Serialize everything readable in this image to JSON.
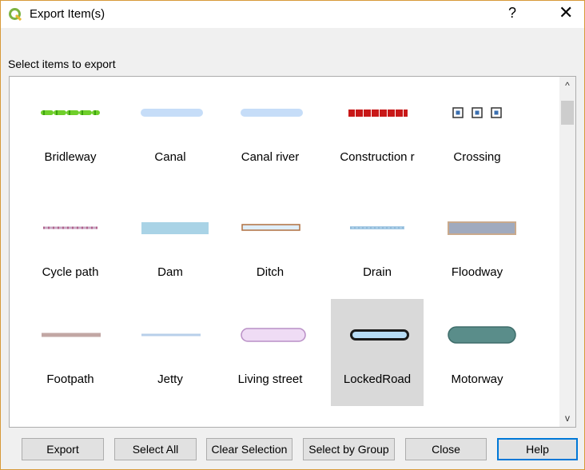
{
  "window": {
    "title": "Export Item(s)",
    "help_glyph": "?",
    "close_glyph": "✕"
  },
  "prompt": "Select items to export",
  "items": [
    {
      "label": "Bridleway",
      "symbol": "bridleway"
    },
    {
      "label": "Canal",
      "symbol": "canal"
    },
    {
      "label": "Canal river",
      "symbol": "canal-river"
    },
    {
      "label": "Construction r",
      "symbol": "construction"
    },
    {
      "label": "Crossing",
      "symbol": "crossing"
    },
    {
      "label": "Cycle path",
      "symbol": "cycle-path"
    },
    {
      "label": "Dam",
      "symbol": "dam"
    },
    {
      "label": "Ditch",
      "symbol": "ditch"
    },
    {
      "label": "Drain",
      "symbol": "drain"
    },
    {
      "label": "Floodway",
      "symbol": "floodway"
    },
    {
      "label": "Footpath",
      "symbol": "footpath"
    },
    {
      "label": "Jetty",
      "symbol": "jetty"
    },
    {
      "label": "Living street",
      "symbol": "living-street"
    },
    {
      "label": "LockedRoad",
      "symbol": "locked-road",
      "selected": true
    },
    {
      "label": "Motorway",
      "symbol": "motorway"
    }
  ],
  "buttons": {
    "export": "Export",
    "select_all": "Select All",
    "clear_selection": "Clear Selection",
    "select_by_group": "Select by Group",
    "close": "Close",
    "help": "Help"
  },
  "scroll": {
    "up": "^",
    "down": "v"
  },
  "colors": {
    "default_button_border": "#0078d7",
    "selection": "#d9d9d9",
    "qgis_green": "#7cb342"
  }
}
